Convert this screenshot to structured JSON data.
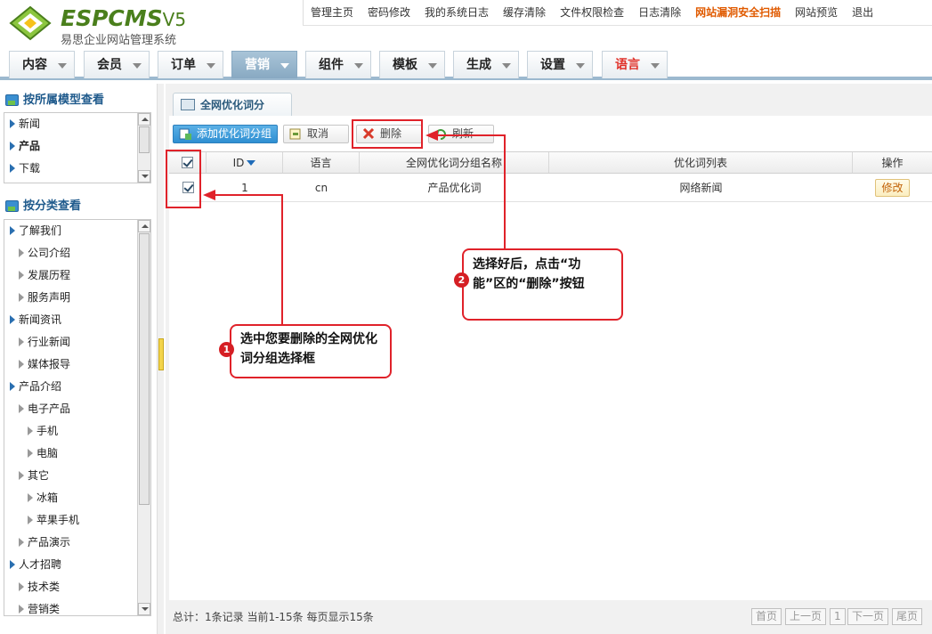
{
  "logo": {
    "brand": "ESPCMS",
    "version": "V5",
    "subtitle": "易思企业网站管理系统"
  },
  "topnav": [
    "管理主页",
    "密码修改",
    "我的系统日志",
    "缓存清除",
    "文件权限检查",
    "日志清除",
    "网站漏洞安全扫描",
    "网站预览",
    "退出"
  ],
  "topnav_highlight_index": 6,
  "main_tabs": [
    "内容",
    "会员",
    "订单",
    "营销",
    "组件",
    "模板",
    "生成",
    "设置",
    "语言"
  ],
  "active_tab": "营销",
  "sidebar": {
    "model_title": "按所属模型查看",
    "model_items": [
      "新闻",
      "产品",
      "下载"
    ],
    "category_title": "按分类查看",
    "category_items": [
      "了解我们",
      "公司介绍",
      "发展历程",
      "服务声明",
      "新闻资讯",
      "行业新闻",
      "媒体报导",
      "产品介绍",
      "电子产品",
      "手机",
      "电脑",
      "其它",
      "冰箱",
      "苹果手机",
      "产品演示",
      "人才招聘",
      "技术类",
      "营销类"
    ]
  },
  "panel": {
    "tab_title": "全网优化词分"
  },
  "toolbar": {
    "add": "添加优化词分组",
    "cancel": "取消",
    "delete": "删除",
    "refresh": "刷新"
  },
  "table": {
    "headers": [
      "ID",
      "语言",
      "全网优化词分组名称",
      "优化词列表",
      "操作"
    ],
    "rows": [
      {
        "id": "1",
        "lang": "cn",
        "group_name": "产品优化词",
        "words": "网络新闻",
        "action": "修改"
      }
    ]
  },
  "footer": {
    "summary": "总计：1条记录 当前1-15条 每页显示15条",
    "first": "首页",
    "prev": "上一页",
    "page": "1",
    "next": "下一页",
    "last": "尾页"
  },
  "annotations": {
    "step1_num": "1",
    "step1": "选中您要删除的全网优化词分组选择框",
    "step2_num": "2",
    "step2": "选择好后，点击“功能”区的“删除”按钮"
  },
  "colors": {
    "accent": "#e0222a",
    "active_tab": "#8fb0c8",
    "highlight_link": "#e05a00"
  }
}
